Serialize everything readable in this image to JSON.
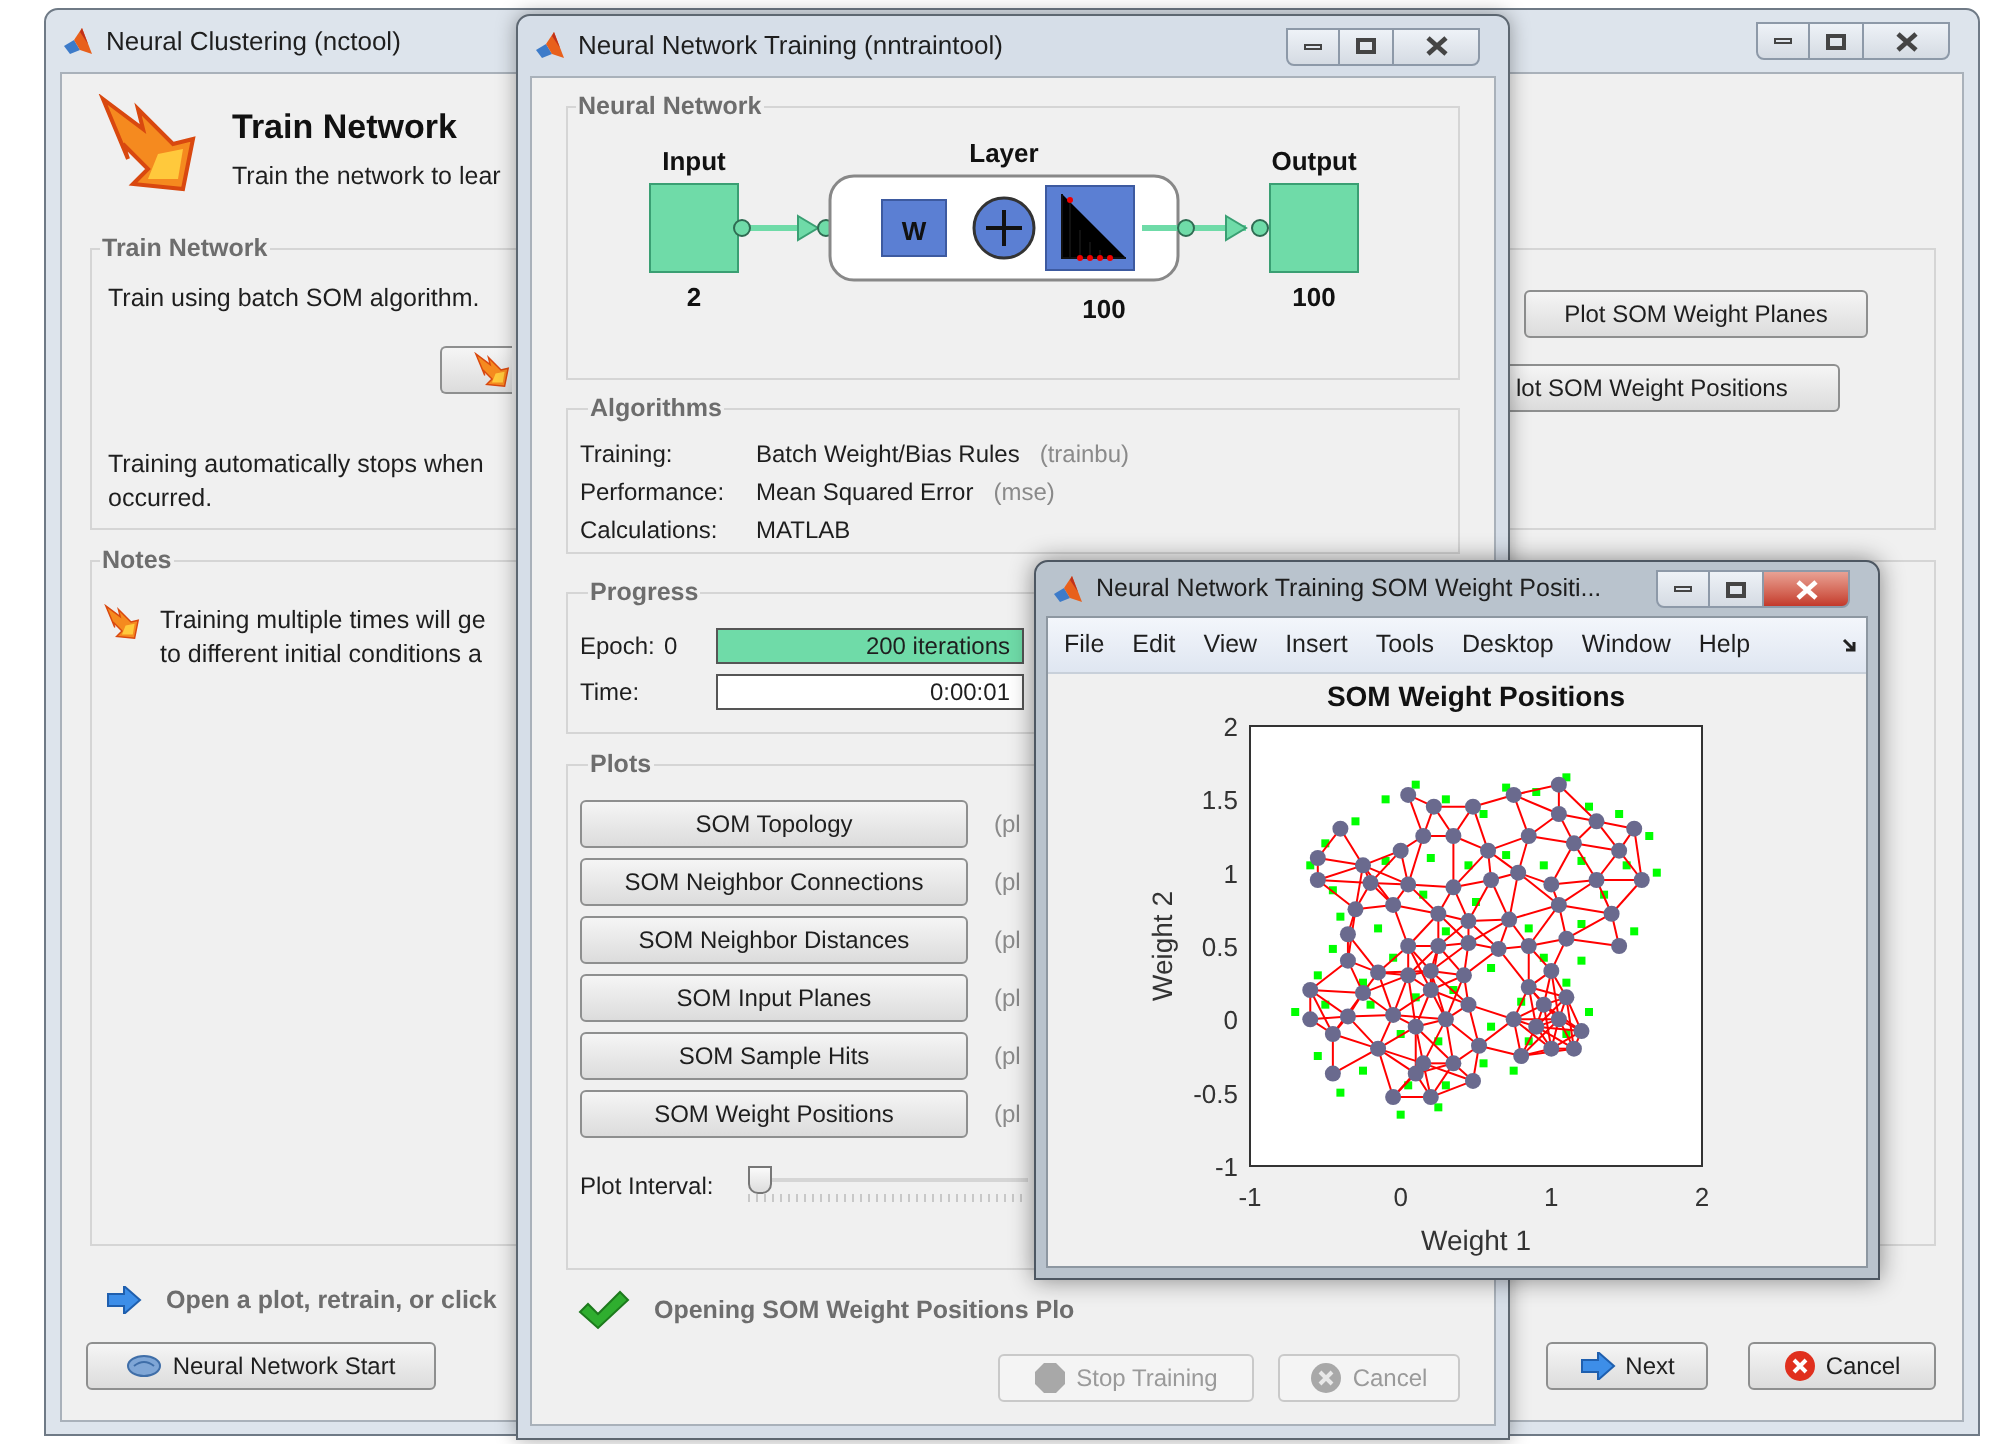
{
  "main_window": {
    "title": "Neural Clustering (nctool)",
    "heading": "Train Network",
    "subheading": "Train the network to lear",
    "train_group": {
      "title": "Train Network",
      "description": "Train using batch SOM algorithm.",
      "note_lines": [
        "Training automatically stops when",
        "occurred."
      ],
      "plot_buttons": [
        "Plot SOM Weight Planes",
        "lot SOM Weight Positions"
      ]
    },
    "notes_group": {
      "title": "Notes",
      "lines": [
        "Training multiple times will ge",
        "to different initial conditions a"
      ]
    },
    "hint": "Open a plot, retrain, or click",
    "buttons": [
      {
        "label": "Neural Network Start",
        "kind": "start"
      },
      {
        "label": "Next",
        "kind": "next"
      },
      {
        "label": "Cancel",
        "kind": "cancel"
      }
    ]
  },
  "training_window": {
    "title": "Neural Network Training (nntraintool)",
    "network": {
      "title": "Neural Network",
      "input_label": "Input",
      "input_size": "2",
      "layer_label": "Layer",
      "weight_label": "W",
      "layer_size": "100",
      "output_label": "Output",
      "output_size": "100"
    },
    "algorithms": {
      "title": "Algorithms",
      "rows": [
        {
          "label": "Training:",
          "value": "Batch Weight/Bias Rules",
          "code": "(trainbu)"
        },
        {
          "label": "Performance:",
          "value": "Mean Squared Error",
          "code": "(mse)"
        },
        {
          "label": "Calculations:",
          "value": "MATLAB"
        }
      ]
    },
    "progress": {
      "title": "Progress",
      "rows": [
        {
          "kind": "bar",
          "label": "Epoch:",
          "start": "0",
          "reading": "200 iterations",
          "level": 1
        },
        {
          "kind": "field",
          "label": "Time:",
          "reading": "0:00:01"
        }
      ]
    },
    "plots": {
      "title": "Plots",
      "buttons": [
        {
          "label": "SOM Topology",
          "hint": "(pl"
        },
        {
          "label": "SOM Neighbor Connections",
          "hint": "(pl"
        },
        {
          "label": "SOM Neighbor Distances",
          "hint": "(pl"
        },
        {
          "label": "SOM Input Planes",
          "hint": "(pl"
        },
        {
          "label": "SOM Sample Hits",
          "hint": "(pl"
        },
        {
          "label": "SOM Weight Positions",
          "hint": "(pl"
        }
      ],
      "interval": {
        "label": "Plot Interval:",
        "level": 0
      }
    },
    "status": "Opening SOM Weight Positions Plo",
    "buttons": [
      {
        "label": "Stop Training",
        "kind": "stop",
        "disabled": true
      },
      {
        "label": "Cancel",
        "kind": "cancel",
        "disabled": true
      }
    ]
  },
  "figure_window": {
    "title": "Neural Network Training SOM Weight Positi...",
    "menu": [
      "File",
      "Edit",
      "View",
      "Insert",
      "Tools",
      "Desktop",
      "Window",
      "Help"
    ],
    "chart_data": {
      "type": "scatter",
      "title": "SOM Weight Positions",
      "xlabel": "Weight 1",
      "ylabel": "Weight 2",
      "xlim": [
        -1,
        2
      ],
      "ylim": [
        -1,
        2
      ],
      "xticks": [
        {
          "value": -1,
          "label": "-1"
        },
        {
          "value": 0,
          "label": "0"
        },
        {
          "value": 1,
          "label": "1"
        },
        {
          "value": 2,
          "label": "2"
        }
      ],
      "yticks": [
        {
          "value": -1,
          "label": "-1"
        },
        {
          "value": -0.5,
          "label": "-0.5"
        },
        {
          "value": 0,
          "label": "0"
        },
        {
          "value": 0.5,
          "label": "0.5"
        },
        {
          "value": 1,
          "label": "1"
        },
        {
          "value": 1.5,
          "label": "1.5"
        },
        {
          "value": 2,
          "label": "2"
        }
      ],
      "series": [
        {
          "color": "#00ff00",
          "x": [
            -0.5,
            -0.3,
            -0.1,
            0.1,
            0.3,
            0.55,
            0.7,
            0.9,
            1.1,
            1.25,
            1.45,
            1.65,
            1.7,
            1.5,
            -0.6,
            -0.45,
            -0.1,
            0.2,
            0.45,
            0.7,
            0.95,
            1.2,
            1.35,
            1.55,
            -0.4,
            -0.15,
            0.15,
            0.5,
            0.85,
            1.2,
            -0.45,
            -0.05,
            0.3,
            0.6,
            0.95,
            1.2,
            -0.55,
            -0.25,
            0.1,
            0.35,
            0.8,
            1.1,
            1.25,
            -0.7,
            -0.5,
            -0.2,
            0.0,
            0.25,
            0.6,
            0.85,
            1.1,
            -0.55,
            -0.25,
            0.05,
            0.3,
            0.55,
            0.75,
            -0.4,
            0.0,
            0.25
          ],
          "values": [
            1.2,
            1.35,
            1.5,
            1.6,
            1.5,
            1.4,
            1.58,
            1.55,
            1.65,
            1.45,
            1.4,
            1.25,
            1.0,
            1.05,
            1.05,
            0.88,
            1.08,
            1.1,
            1.05,
            1.12,
            1.05,
            1.08,
            0.85,
            0.6,
            0.7,
            0.62,
            0.85,
            0.8,
            0.62,
            0.65,
            0.48,
            0.42,
            0.6,
            0.35,
            0.42,
            0.4,
            0.3,
            0.25,
            0.15,
            0.2,
            0.12,
            0.25,
            0.05,
            0.05,
            0.1,
            0.1,
            -0.1,
            -0.15,
            -0.05,
            -0.15,
            -0.1,
            -0.25,
            -0.35,
            -0.45,
            -0.45,
            -0.3,
            -0.35,
            -0.5,
            -0.65,
            -0.6
          ]
        },
        {
          "color": "#6a6a8e",
          "x": [
            -0.4,
            0.05,
            0.22,
            0.48,
            0.75,
            1.05,
            1.05,
            1.3,
            1.55,
            -0.55,
            -0.25,
            0.0,
            0.15,
            0.35,
            0.58,
            0.85,
            1.15,
            1.45,
            1.6,
            -0.55,
            -0.2,
            0.05,
            0.35,
            0.6,
            0.78,
            1.0,
            1.3,
            -0.3,
            -0.05,
            0.25,
            0.45,
            0.72,
            1.05,
            1.4,
            -0.35,
            0.05,
            0.25,
            0.45,
            0.65,
            0.85,
            1.1,
            1.45,
            -0.35,
            -0.15,
            0.05,
            0.2,
            0.42,
            0.85,
            1.0,
            -0.6,
            -0.25,
            0.2,
            0.45,
            0.95,
            1.1,
            -0.6,
            -0.35,
            -0.05,
            0.1,
            0.3,
            0.75,
            0.9,
            1.05,
            1.2,
            -0.45,
            -0.15,
            0.15,
            0.52,
            0.8,
            1.0,
            1.15,
            -0.45,
            0.1,
            0.35,
            0.48,
            -0.05,
            0.2
          ],
          "values": [
            1.3,
            1.53,
            1.45,
            1.45,
            1.53,
            1.6,
            1.4,
            1.35,
            1.3,
            1.1,
            1.05,
            1.15,
            1.25,
            1.25,
            1.15,
            1.25,
            1.2,
            1.15,
            0.95,
            0.95,
            0.93,
            0.92,
            0.9,
            0.95,
            1.0,
            0.92,
            0.95,
            0.75,
            0.78,
            0.72,
            0.67,
            0.68,
            0.78,
            0.72,
            0.58,
            0.5,
            0.5,
            0.52,
            0.48,
            0.5,
            0.55,
            0.5,
            0.4,
            0.32,
            0.3,
            0.33,
            0.3,
            0.22,
            0.33,
            0.2,
            0.18,
            0.2,
            0.1,
            0.1,
            0.15,
            0.0,
            0.02,
            0.03,
            -0.05,
            0.0,
            0.0,
            -0.05,
            0.0,
            -0.08,
            -0.1,
            -0.2,
            -0.3,
            -0.18,
            -0.25,
            -0.2,
            -0.2,
            -0.37,
            -0.37,
            -0.3,
            -0.42,
            -0.53,
            -0.53
          ]
        }
      ]
    }
  }
}
